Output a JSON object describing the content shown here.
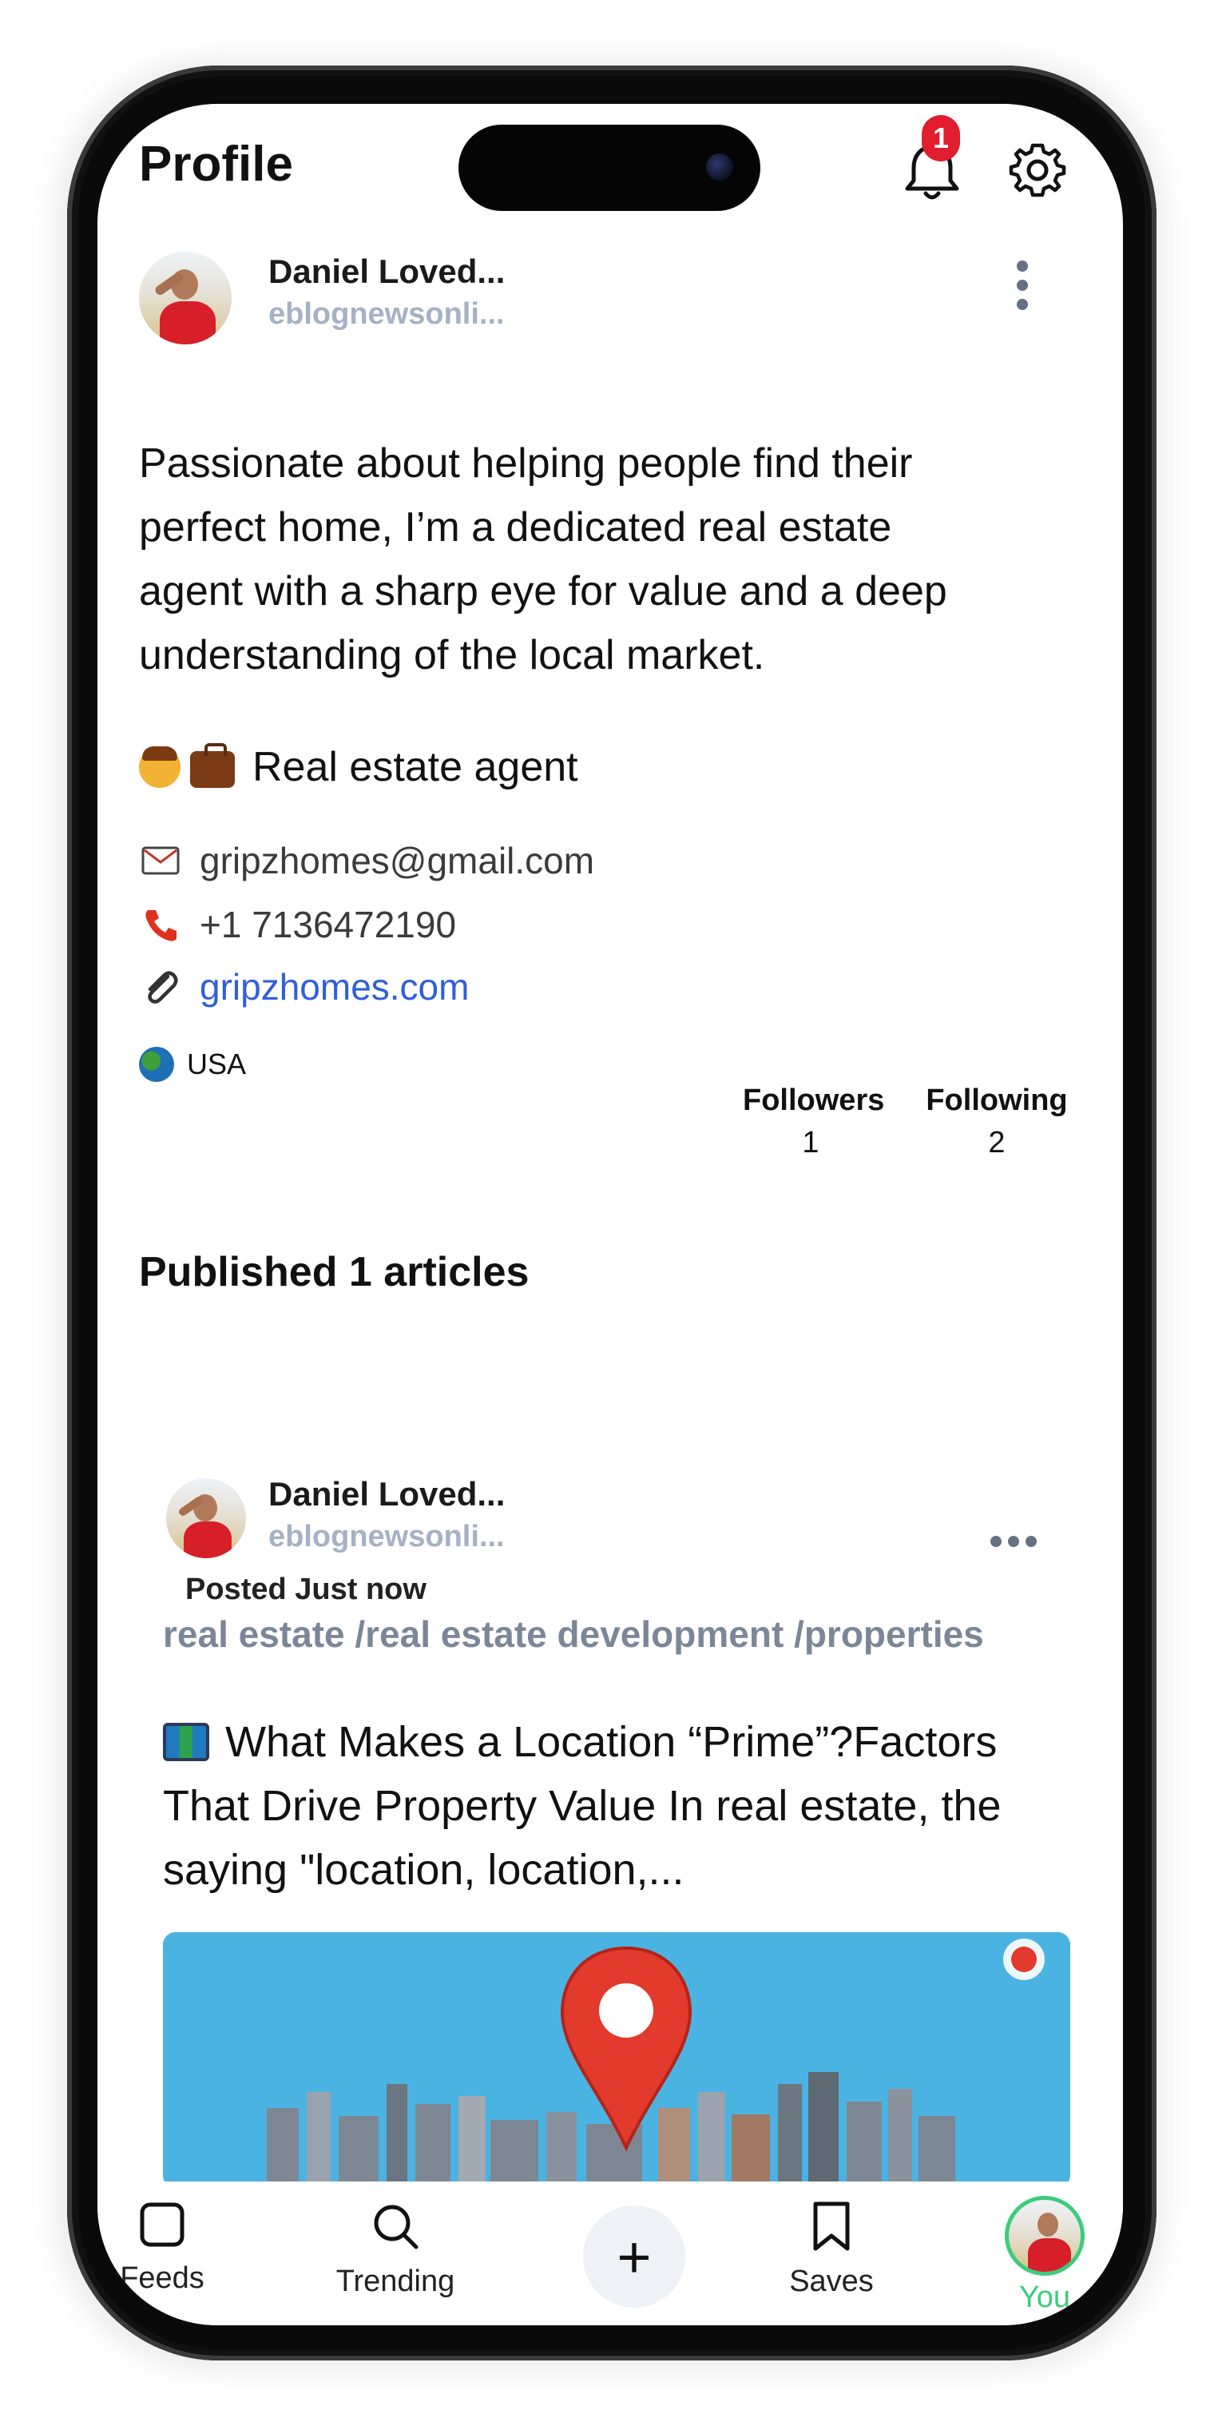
{
  "header": {
    "title": "Profile",
    "notification_count": "1"
  },
  "profile": {
    "name": "Daniel Loved...",
    "handle": "eblognewsonli...",
    "bio": "Passionate about helping people find their perfect home, I’m a dedicated real estate agent with a sharp eye for value and a deep understanding of the local market.",
    "role": "Real estate agent",
    "email": "gripzhomes@gmail.com",
    "phone": "+1 7136472190",
    "website": "gripzhomes.com",
    "country": "USA",
    "followers_label": "Followers",
    "followers_count": "1",
    "following_label": "Following",
    "following_count": "2"
  },
  "articles": {
    "section_title": "Published 1 articles",
    "items": [
      {
        "author_name": "Daniel Loved...",
        "author_handle": "eblognewsonli...",
        "posted": "Posted Just now",
        "tags": "real estate /real estate development /properties",
        "excerpt": "What Makes a Location “Prime”?Factors That Drive Property Value  In real estate, the saying \"location, location,..."
      }
    ]
  },
  "nav": {
    "feeds": "Feeds",
    "trending": "Trending",
    "saves": "Saves",
    "you": "You",
    "plus": "+"
  },
  "colors": {
    "badge": "#e11d2e",
    "link": "#2f5fd9",
    "handle": "#a5b1c4",
    "tags": "#7b8798",
    "active_nav": "#3ccc7c"
  }
}
